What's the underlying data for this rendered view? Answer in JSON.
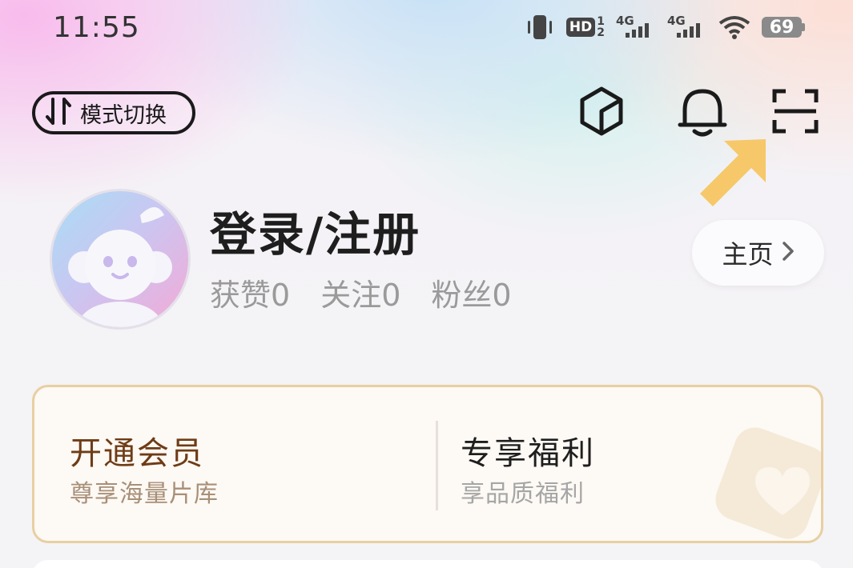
{
  "status_bar": {
    "time": "11:55",
    "hd_label": "HD",
    "sim1_label": "1",
    "sim2_label": "2",
    "network1": "4G",
    "network2": "4G",
    "battery": "69"
  },
  "header": {
    "mode_switch_label": "模式切换"
  },
  "profile": {
    "username": "登录/注册",
    "stats": [
      {
        "label": "获赞0"
      },
      {
        "label": "关注0"
      },
      {
        "label": "粉丝0"
      }
    ],
    "home_label": "主页"
  },
  "vip_card": {
    "left_title": "开通会员",
    "left_subtitle": "尊享海量片库",
    "right_title": "专享福利",
    "right_subtitle": "享品质福利"
  },
  "colors": {
    "hint_arrow": "#f6c86a",
    "vip_title": "#6e3c16",
    "vip_border": "#e8cfa2"
  }
}
